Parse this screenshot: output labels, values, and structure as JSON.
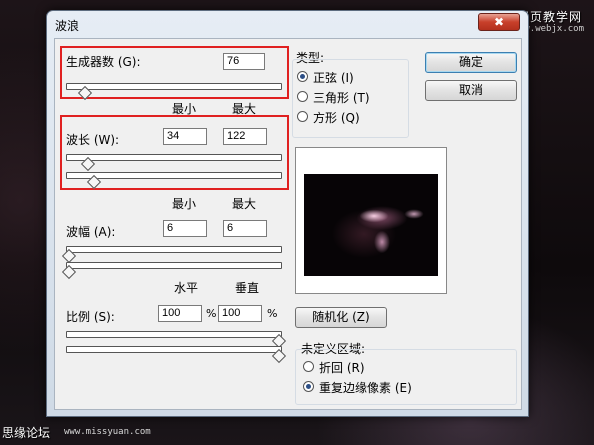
{
  "watermark": {
    "top_text": "网页教学网",
    "top_url": "www.webjx.com",
    "bottom_text": "思缘论坛",
    "bottom_url": "www.missyuan.com"
  },
  "dialog": {
    "title": "波浪",
    "close_symbol": "✖"
  },
  "generators": {
    "label": "生成器数 (G):",
    "value": "76",
    "slider_level": 0.1
  },
  "min_max_labels": {
    "min": "最小",
    "max": "最大"
  },
  "wavelength": {
    "label": "波长 (W):",
    "min_value": "34",
    "max_value": "122",
    "slider_min_level": 0.1,
    "slider_max_level": 0.13
  },
  "amplitude": {
    "label": "波幅 (A):",
    "min_value": "6",
    "max_value": "6",
    "slider_min_level": 0.0,
    "slider_max_level": 0.0
  },
  "scale": {
    "horizontal_label": "水平",
    "vertical_label": "垂直",
    "label": "比例 (S):",
    "horizontal_value": "100",
    "vertical_value": "100",
    "unit": "%",
    "slider_h_level": 1.0,
    "slider_v_level": 1.0
  },
  "type_group": {
    "title": "类型:",
    "options": [
      {
        "label": "正弦 (I)",
        "checked": true
      },
      {
        "label": "三角形 (T)",
        "checked": false
      },
      {
        "label": "方形 (Q)",
        "checked": false
      }
    ]
  },
  "buttons": {
    "ok": "确定",
    "cancel": "取消",
    "randomize": "随机化 (Z)"
  },
  "undefined_area": {
    "title": "未定义区域:",
    "options": [
      {
        "label": "折回 (R)",
        "checked": false
      },
      {
        "label": "重复边缘像素 (E)",
        "checked": true
      }
    ]
  }
}
